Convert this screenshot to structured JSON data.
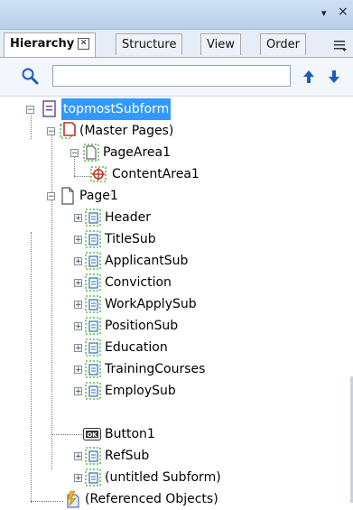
{
  "window": {
    "dropdown_glyph": "▾",
    "close_glyph": "×"
  },
  "tabs": [
    {
      "label": "Hierarchy",
      "active": true
    },
    {
      "label": "Structure",
      "active": false
    },
    {
      "label": "View",
      "active": false
    },
    {
      "label": "Order",
      "active": false
    }
  ],
  "tab_close_glyph": "✕",
  "search": {
    "value": "",
    "placeholder": ""
  },
  "tree": {
    "root": "topmostSubform",
    "master_pages": "(Master Pages)",
    "page_area": "PageArea1",
    "content_area": "ContentArea1",
    "page": "Page1",
    "subforms": [
      "Header",
      "TitleSub",
      "ApplicantSub",
      "Conviction",
      "WorkApplySub",
      "PositionSub",
      "Education",
      "TrainingCourses",
      "EmploySub"
    ],
    "button": "Button1",
    "ref_sub": "RefSub",
    "untitled": "(untitled Subform)",
    "referenced": "(Referenced Objects)"
  },
  "colors": {
    "selection": "#3399ff",
    "subform_dash": "#3fae2a",
    "icon_accent": "#c0302a",
    "arrow_blue": "#1a5fb4"
  }
}
